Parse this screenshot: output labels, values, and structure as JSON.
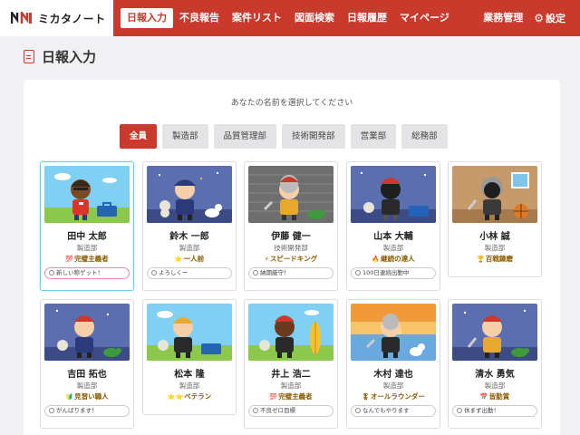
{
  "header": {
    "logo_text": "ミカタノート",
    "nav": [
      "日報入力",
      "不良報告",
      "案件リスト",
      "図面検索",
      "日報履歴",
      "マイページ"
    ],
    "right": [
      "業務管理",
      "設定"
    ]
  },
  "page": {
    "title": "日報入力"
  },
  "prompt": "あなたの名前を選択してください",
  "filters": [
    "全員",
    "製造部",
    "品質管理部",
    "技術開発部",
    "営業部",
    "総務部"
  ],
  "employees": [
    {
      "name": "田中 太郎",
      "dept": "製造部",
      "title_icon": "💯",
      "title": "完璧主義者",
      "status": "新しい称ゲット！"
    },
    {
      "name": "鈴木 一郎",
      "dept": "製造部",
      "title_icon": "⭐",
      "title": "一人前",
      "status": "よろしくー"
    },
    {
      "name": "伊藤 健一",
      "dept": "技術開発部",
      "title_icon": "⚡",
      "title": "スピードキング",
      "status": "納期厳守！"
    },
    {
      "name": "山本 大輔",
      "dept": "製造部",
      "title_icon": "🔥",
      "title": "継続の達人",
      "status": "100日連続出勤中"
    },
    {
      "name": "小林 誠",
      "dept": "製造部",
      "title_icon": "🏆",
      "title": "百戦錬磨",
      "status": ""
    },
    {
      "name": "吉田 拓也",
      "dept": "製造部",
      "title_icon": "🔰",
      "title": "見習い職人",
      "status": "がんばります！"
    },
    {
      "name": "松本 隆",
      "dept": "製造部",
      "title_icon": "⭐⭐",
      "title": "ベテラン",
      "status": ""
    },
    {
      "name": "井上 浩二",
      "dept": "製造部",
      "title_icon": "💯",
      "title": "完璧主義者",
      "status": "不良ゼロ目標"
    },
    {
      "name": "木村 達也",
      "dept": "製造部",
      "title_icon": "🎖",
      "title": "オールラウンダー",
      "status": "なんでもやります"
    },
    {
      "name": "清水 勇気",
      "dept": "製造部",
      "title_icon": "📅",
      "title": "皆勤賞",
      "status": "休まず出勤！"
    }
  ],
  "colors": {
    "brand": "#c9392c",
    "selected_border": "#6fd0ea"
  }
}
